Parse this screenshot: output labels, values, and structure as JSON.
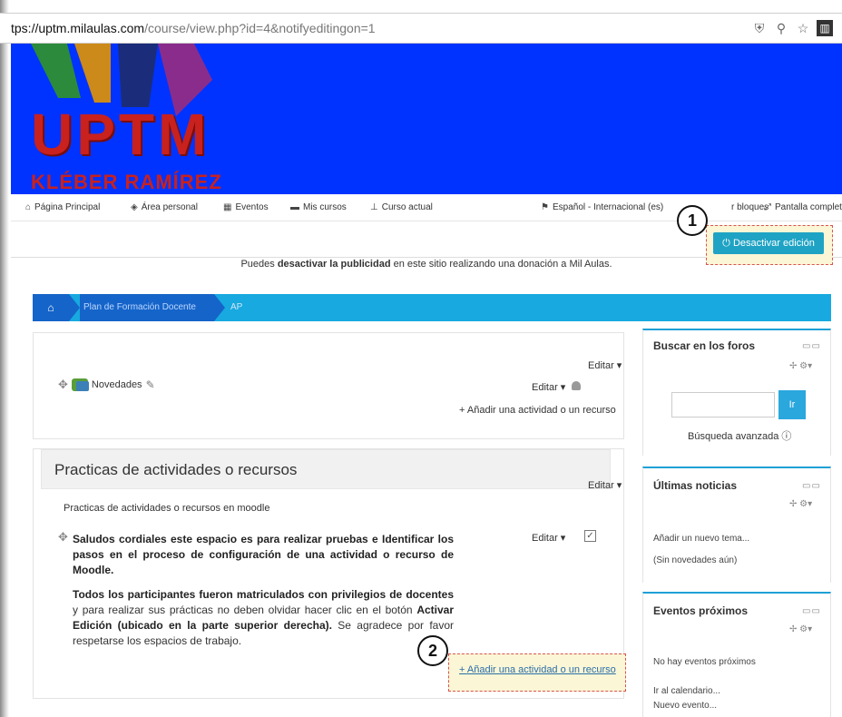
{
  "browser": {
    "url_host": "tps://uptm.milaulas.com",
    "url_rest": "/course/view.php?id=4&notifyeditingon=1"
  },
  "banner": {
    "logo_text": "UPTM",
    "logo_sub": "KLÉBER RAMÍREZ"
  },
  "nav": {
    "items": [
      "Página Principal",
      "Área personal",
      "Eventos",
      "Mis cursos",
      "Curso actual"
    ],
    "language": "Español - Internacional (es)",
    "blocks": "r bloques",
    "fullscreen": "Pantalla completa"
  },
  "edit_toggle": {
    "label": "Desactivar edición",
    "color": "#1fa3c4"
  },
  "callouts": {
    "one": "1",
    "two": "2"
  },
  "ad": {
    "prefix": "Puedes ",
    "bold": "desactivar la publicidad",
    "suffix": " en este sitio realizando una donación a Mil Aulas."
  },
  "breadcrumb": {
    "items": [
      "Plan de Formación Docente",
      "AP"
    ]
  },
  "section1": {
    "edit": "Editar",
    "activity_name": "Novedades",
    "activity_edit": "Editar",
    "add": "+ Añadir una actividad o un recurso"
  },
  "section2": {
    "title": "Practicas de actividades o recursos",
    "edit": "Editar",
    "summary": "Practicas de actividades o recursos en moodle",
    "label_edit": "Editar",
    "para1": "Saludos cordiales este espacio es para realizar pruebas e Identificar los pasos en el proceso de configuración de una actividad o recurso de Moodle.",
    "para2_a": "Todos los participantes fueron matriculados con privilegios de docentes",
    "para2_b": " y para realizar sus prácticas no deben olvidar hacer clic en el botón ",
    "para2_c": "Activar Edición (ubicado en la parte superior derecha).",
    "para2_d": " Se agradece por favor respetarse los espacios de trabajo.",
    "add": "Añadir una actividad o un recurso"
  },
  "blocks": {
    "forums": {
      "title": "Buscar en los foros",
      "button": "Ir",
      "advanced": "Búsqueda avanzada"
    },
    "news": {
      "title": "Últimas noticias",
      "add": "Añadir un nuevo tema...",
      "empty": "(Sin novedades aún)"
    },
    "events": {
      "title": "Eventos próximos",
      "empty": "No hay eventos próximos",
      "calendar": "Ir al calendario...",
      "new": "Nuevo evento..."
    }
  },
  "colors": {
    "banner": "#0033ff",
    "logo": "#c8211e",
    "breadcrumb": "#17a9e0",
    "breadcrumb_dark": "#1564c9"
  }
}
